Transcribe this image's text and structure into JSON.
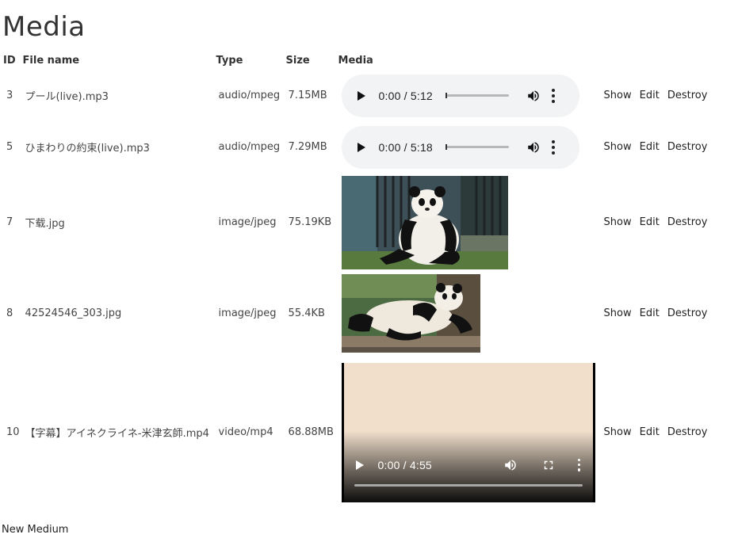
{
  "page": {
    "title": "Media"
  },
  "table": {
    "headers": {
      "id": "ID",
      "file_name": "File name",
      "type": "Type",
      "size": "Size",
      "media": "Media"
    },
    "rows": [
      {
        "id": "3",
        "file_name": "プール(live).mp3",
        "type": "audio/mpeg",
        "size": "7.15MB",
        "media_kind": "audio",
        "player_time": "0:00 / 5:12"
      },
      {
        "id": "5",
        "file_name": "ひまわりの約束(live).mp3",
        "type": "audio/mpeg",
        "size": "7.29MB",
        "media_kind": "audio",
        "player_time": "0:00 / 5:18"
      },
      {
        "id": "7",
        "file_name": "下载.jpg",
        "type": "image/jpeg",
        "size": "75.19KB",
        "media_kind": "image",
        "image_desc": "panda-sitting"
      },
      {
        "id": "8",
        "file_name": "42524546_303.jpg",
        "type": "image/jpeg",
        "size": "55.4KB",
        "media_kind": "image",
        "image_desc": "panda-lying"
      },
      {
        "id": "10",
        "file_name": "【字幕】アイネクライネ-米津玄師.mp4",
        "type": "video/mp4",
        "size": "68.88MB",
        "media_kind": "video",
        "player_time": "0:00 / 4:55"
      }
    ],
    "actions": {
      "show": "Show",
      "edit": "Edit",
      "destroy": "Destroy"
    }
  },
  "links": {
    "new_medium": "New Medium"
  },
  "icons": {
    "play": "play-icon",
    "volume": "volume-icon",
    "more": "more-vert-icon",
    "fullscreen": "fullscreen-icon"
  }
}
